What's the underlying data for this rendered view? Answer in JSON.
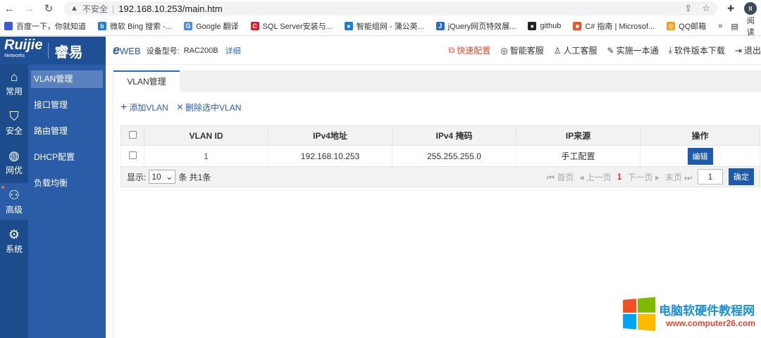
{
  "browser": {
    "insecure": "不安全",
    "url": "192.168.10.253/main.htm",
    "avatar": "Ⅲ"
  },
  "bookmarks": [
    {
      "label": "百度一下，你就知道",
      "color": "#3a5bd8",
      "glyph": "🐾"
    },
    {
      "label": "微软 Bing 搜索 -...",
      "color": "#1a7fd8",
      "glyph": "b"
    },
    {
      "label": "Google 翻译",
      "color": "#4a8af4",
      "glyph": "G"
    },
    {
      "label": "SQL Server安装与...",
      "color": "#d8202a",
      "glyph": "C"
    },
    {
      "label": "智能组网 - 蒲公英...",
      "color": "#1a7fd8",
      "glyph": "●"
    },
    {
      "label": "jQuery网页特效展...",
      "color": "#2a6ac8",
      "glyph": "J"
    },
    {
      "label": "github",
      "color": "#222",
      "glyph": "●"
    },
    {
      "label": "C# 指南 | Microsof...",
      "color": "#f25022",
      "glyph": "■"
    },
    {
      "label": "QQ邮箱",
      "color": "#f0a020",
      "glyph": "◎"
    }
  ],
  "bookmarks_more": "»",
  "reading_list": "阅读",
  "logo": {
    "brand": "Ruijie",
    "sub": "Networks",
    "cn": "睿易"
  },
  "header": {
    "eweb": "WEB",
    "model_label": "设备型号:",
    "model": "RAC200B",
    "detail": "详细",
    "links": [
      {
        "label": "快速配置",
        "icon": "⧉"
      },
      {
        "label": "智能客服",
        "icon": "◎"
      },
      {
        "label": "人工客服",
        "icon": "♙"
      },
      {
        "label": "实施一本通",
        "icon": "✎"
      },
      {
        "label": "软件版本下载",
        "icon": "⤓"
      },
      {
        "label": "退出",
        "icon": "⇥"
      }
    ]
  },
  "side1": [
    {
      "label": "常用",
      "icon": "⌂"
    },
    {
      "label": "安全",
      "icon": "⛉"
    },
    {
      "label": "网优",
      "icon": "◍"
    },
    {
      "label": "高级",
      "icon": "⚇"
    },
    {
      "label": "系统",
      "icon": "⚙"
    }
  ],
  "side2": [
    "VLAN管理",
    "接口管理",
    "路由管理",
    "DHCP配置",
    "负载均衡"
  ],
  "tab": "VLAN管理",
  "actions": {
    "add": "添加VLAN",
    "delete": "删除选中VLAN"
  },
  "table": {
    "headers": [
      "VLAN ID",
      "IPv4地址",
      "IPv4 掩码",
      "IP来源",
      "操作"
    ],
    "rows": [
      {
        "vlan_id": "1",
        "ipv4": "192.168.10.253",
        "mask": "255.255.255.0",
        "source": "手工配置",
        "op": "编辑"
      }
    ]
  },
  "footer": {
    "show": "显示:",
    "page_size": "10",
    "total": "条 共1条",
    "first": "首页",
    "prev": "上一页",
    "current": "1",
    "next": "下一页",
    "last": "末页",
    "page_input": "1",
    "confirm": "确定"
  },
  "watermark": {
    "title": "电脑软硬件教程网",
    "url": "www.computer26.com"
  }
}
